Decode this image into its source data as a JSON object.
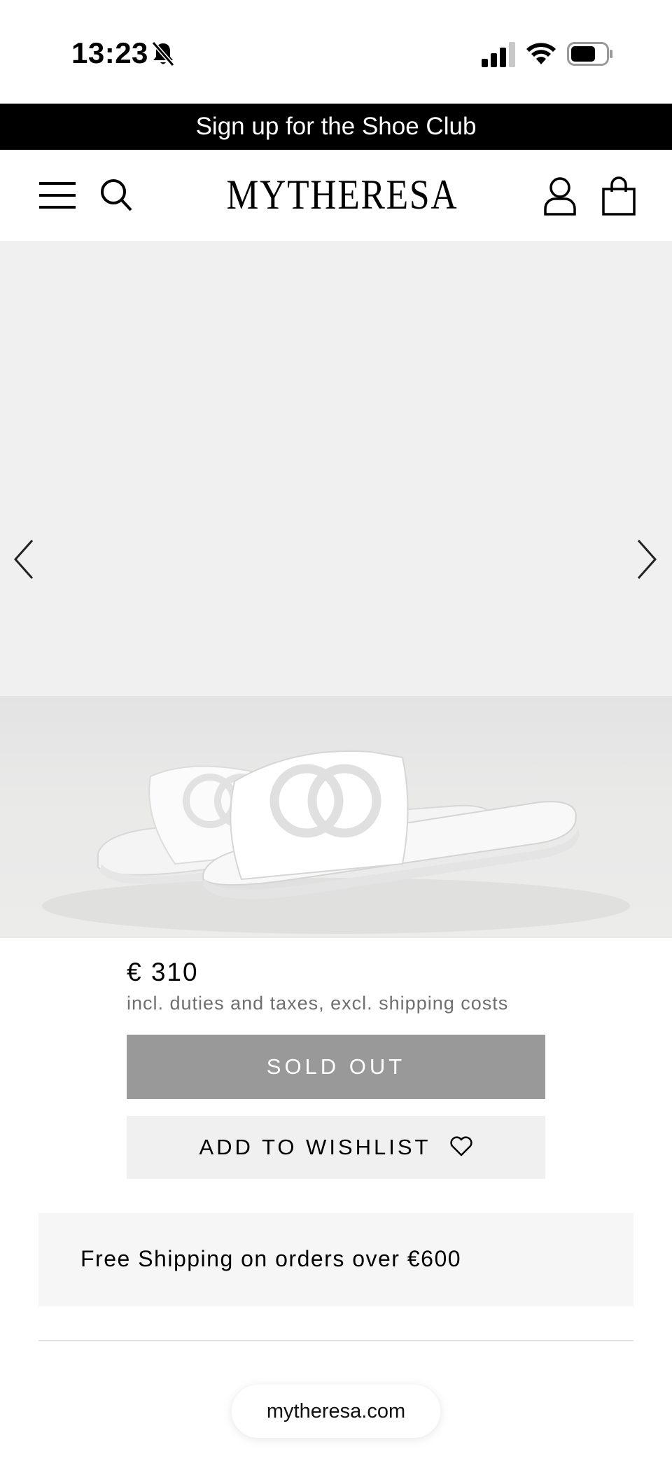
{
  "status_bar": {
    "time": "13:23",
    "icons": [
      "bell-slash-icon",
      "cellular-signal-icon",
      "wifi-icon",
      "battery-icon"
    ]
  },
  "promo": {
    "text": "Sign up for the Shoe Club"
  },
  "header": {
    "logo": "MYTHERESA",
    "icons": [
      "hamburger-menu-icon",
      "search-icon",
      "account-icon",
      "shopping-bag-icon"
    ]
  },
  "gallery": {
    "prev_icon": "chevron-left-icon",
    "next_icon": "chevron-right-icon"
  },
  "product": {
    "price": "€ 310",
    "tax_note": "incl. duties and taxes, excl. shipping costs",
    "sold_out_label": "SOLD OUT",
    "wishlist_label": "ADD TO WISHLIST",
    "wishlist_icon": "heart-icon"
  },
  "shipping": {
    "text": "Free Shipping on orders over €600"
  },
  "browser": {
    "url": "mytheresa.com"
  },
  "colors": {
    "promo_bg": "#000000",
    "sold_out_bg": "#999999",
    "wishlist_bg": "#f0f0f0",
    "gallery_bg": "#f0f0f0",
    "tax_note": "#6f6f6f"
  }
}
